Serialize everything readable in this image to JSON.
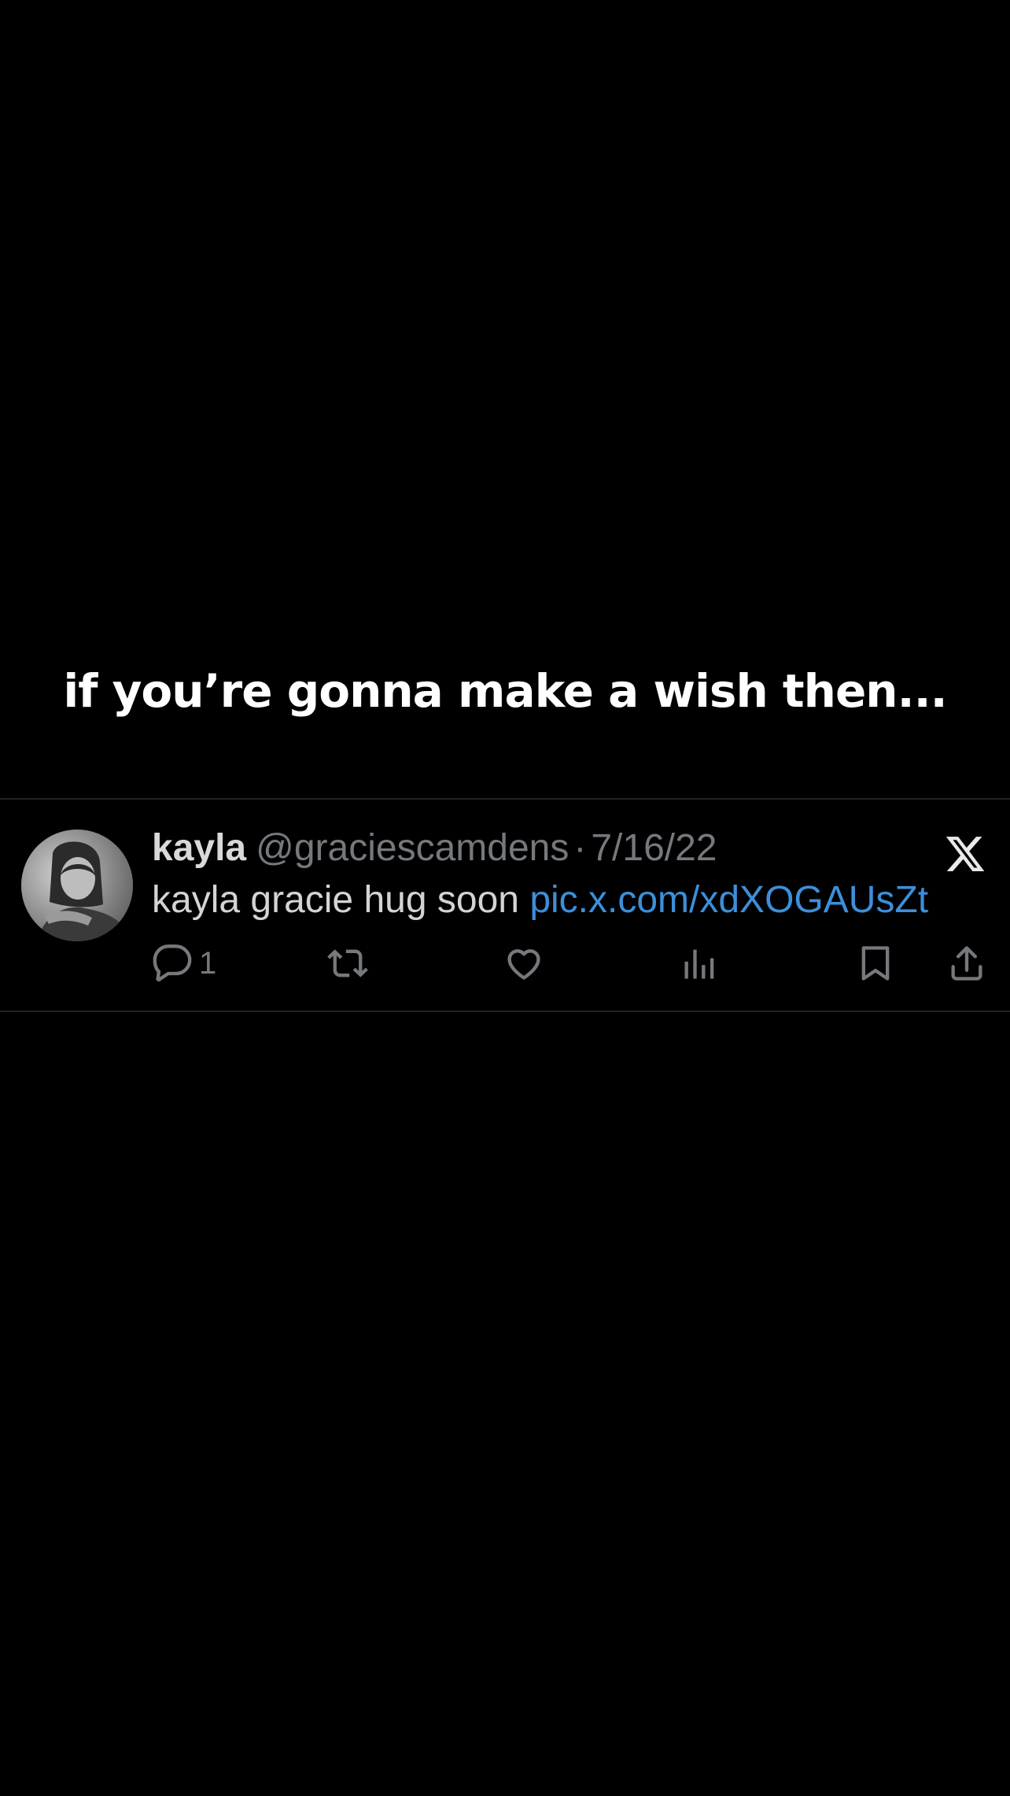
{
  "caption": "if you’re gonna make a wish then...",
  "tweet": {
    "display_name": "kayla",
    "handle": "@graciescamdens",
    "separator": "·",
    "date": "7/16/22",
    "text": "kayla gracie hug soon",
    "link": "pic.x.com/xdXOGAUsZt",
    "reply_count": "1",
    "brand_logo": "x-logo-icon"
  },
  "colors": {
    "background": "#000000",
    "text_primary": "#d9d9d9",
    "text_secondary": "#75797d",
    "link": "#3d8fd9",
    "divider": "#1f2326"
  },
  "icons": {
    "reply": "reply-icon",
    "retweet": "retweet-icon",
    "like": "like-icon",
    "views": "views-icon",
    "bookmark": "bookmark-icon",
    "share": "share-icon"
  }
}
